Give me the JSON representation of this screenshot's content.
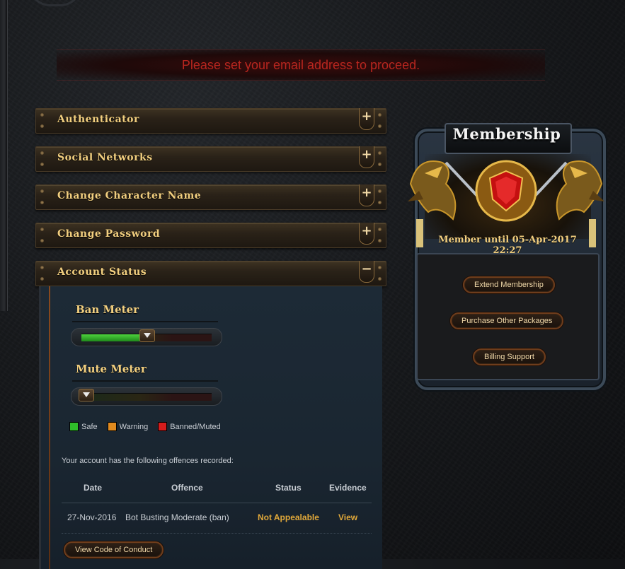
{
  "banner": {
    "message": "Please set your email address to proceed."
  },
  "panels": [
    {
      "label": "Authenticator",
      "toggle": "+"
    },
    {
      "label": "Social Networks",
      "toggle": "+"
    },
    {
      "label": "Change Character Name",
      "toggle": "+"
    },
    {
      "label": "Change Password",
      "toggle": "+"
    },
    {
      "label": "Account Status",
      "toggle": "−"
    }
  ],
  "account_status": {
    "ban_meter": {
      "title": "Ban Meter",
      "level": 0.5
    },
    "mute_meter": {
      "title": "Mute Meter",
      "level": 0.0
    },
    "legend": [
      {
        "label": "Safe",
        "color": "#2fbf2a"
      },
      {
        "label": "Warning",
        "color": "#e08a1e"
      },
      {
        "label": "Banned/Muted",
        "color": "#d41c1c"
      }
    ],
    "offences_note": "Your account has the following offences recorded:",
    "table": {
      "headers": [
        "Date",
        "Offence",
        "Status",
        "Evidence"
      ],
      "rows": [
        {
          "date": "27-Nov-2016",
          "offence": "Bot Busting Moderate (ban)",
          "status": "Not Appealable",
          "evidence": "View"
        }
      ]
    },
    "code_of_conduct_button": "View Code of Conduct"
  },
  "membership": {
    "title": "Membership",
    "expiry": "Member until 05-Apr-2017 22:27",
    "buttons": [
      "Extend Membership",
      "Purchase Other Packages",
      "Billing Support"
    ]
  },
  "colors": {
    "gold_text": "#f2cf7f",
    "alert_red": "#b8261f",
    "status_gold": "#e0a83a"
  }
}
